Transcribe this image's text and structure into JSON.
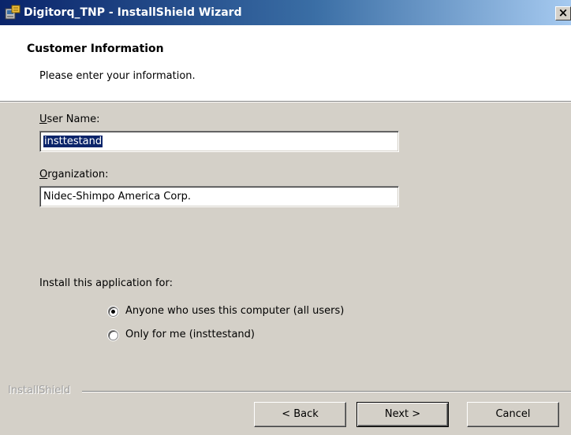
{
  "window": {
    "title": "Digitorq_TNP - InstallShield Wizard",
    "close_glyph": "×"
  },
  "header": {
    "title": "Customer Information",
    "subtitle": "Please enter your information."
  },
  "form": {
    "user_name_label_accel": "U",
    "user_name_label_rest": "ser Name:",
    "user_name_value": "insttestand",
    "organization_label_accel": "O",
    "organization_label_rest": "rganization:",
    "organization_value": "Nidec-Shimpo America Corp."
  },
  "install_for": {
    "label": "Install this application for:",
    "options": [
      {
        "label": "Anyone who uses this computer (all users)",
        "selected": true
      },
      {
        "label": "Only for me (insttestand)",
        "selected": false
      }
    ]
  },
  "footer": {
    "brand": "InstallShield",
    "back_label": "< Back",
    "next_label": "Next >",
    "cancel_label": "Cancel"
  },
  "colors": {
    "title_bar_start": "#0a246a",
    "title_bar_end": "#a6caf0",
    "dialog_bg": "#d4d0c8",
    "selection": "#0a246a"
  },
  "icons": {
    "app": "installer-icon",
    "close": "close-icon"
  }
}
